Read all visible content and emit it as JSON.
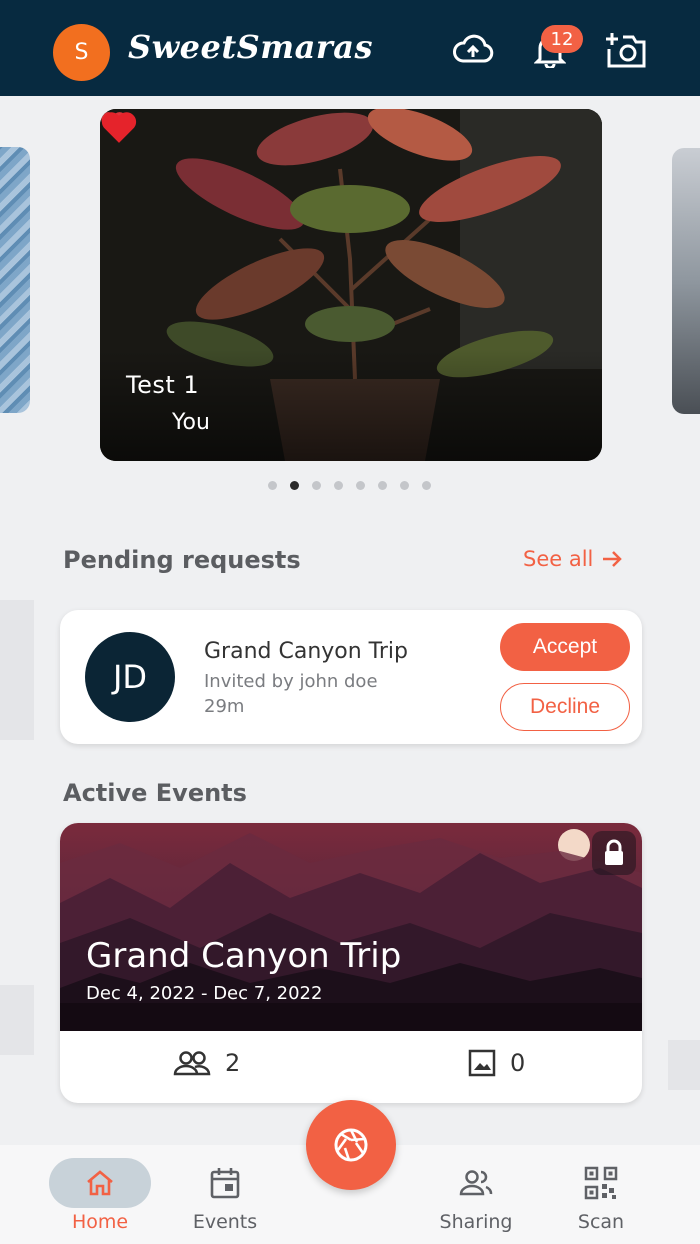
{
  "header": {
    "avatar_initial": "S",
    "brand": "SweetSmaras",
    "notification_count": "12",
    "icons": [
      "cloud-upload-icon",
      "bell-icon",
      "add-photo-icon"
    ]
  },
  "carousel": {
    "title": "Test 1",
    "owner": "You",
    "slide_count": 8,
    "active_index": 1
  },
  "pending": {
    "section_title": "Pending requests",
    "see_all": "See all",
    "request": {
      "initials": "JD",
      "title": "Grand Canyon Trip",
      "subtitle": "Invited by john doe",
      "time": "29m",
      "accept": "Accept",
      "decline": "Decline"
    }
  },
  "active_events": {
    "section_title": "Active Events",
    "event": {
      "title": "Grand Canyon Trip",
      "dates": "Dec 4, 2022 - Dec 7, 2022",
      "members": "2",
      "photos": "0"
    }
  },
  "nav": {
    "home": "Home",
    "events": "Events",
    "sharing": "Sharing",
    "scan": "Scan"
  },
  "colors": {
    "header_bg": "#072a40",
    "accent": "#f26144",
    "avatar": "#f26f1f"
  }
}
